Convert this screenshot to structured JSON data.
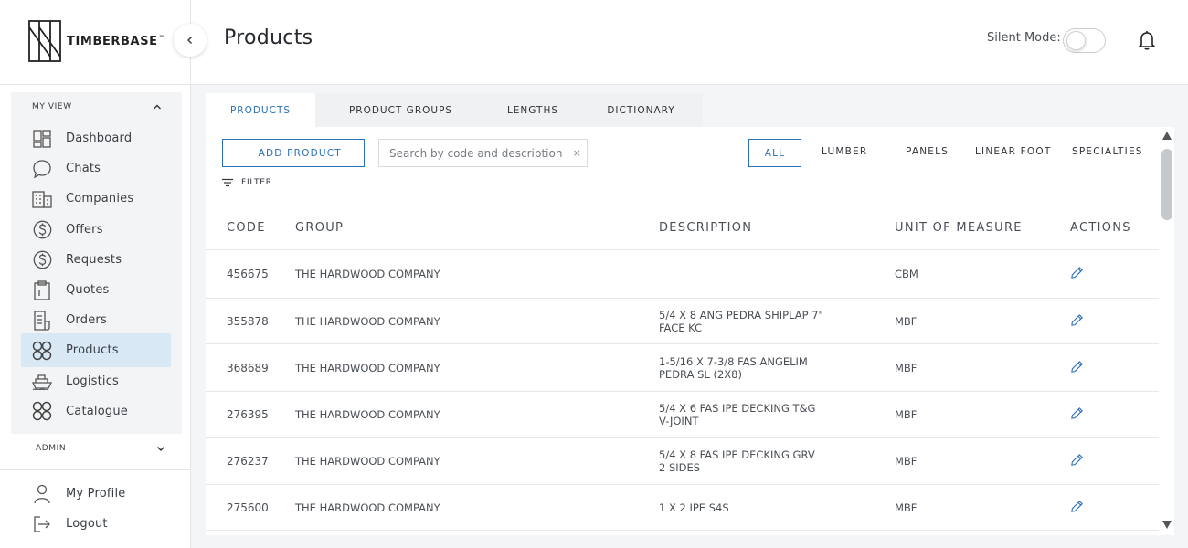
{
  "brand": {
    "name": "TIMBERBASE",
    "tm": "™"
  },
  "sidebar": {
    "section_myview": "MY VIEW",
    "section_admin": "ADMIN",
    "items": [
      {
        "label": "Dashboard",
        "icon": "dashboard-icon"
      },
      {
        "label": "Chats",
        "icon": "chat-icon"
      },
      {
        "label": "Companies",
        "icon": "building-icon"
      },
      {
        "label": "Offers",
        "icon": "dollar-circle-icon"
      },
      {
        "label": "Requests",
        "icon": "dollar-circle-icon"
      },
      {
        "label": "Quotes",
        "icon": "clipboard-icon"
      },
      {
        "label": "Orders",
        "icon": "document-list-icon"
      },
      {
        "label": "Products",
        "icon": "products-grid-icon",
        "active": true
      },
      {
        "label": "Logistics",
        "icon": "ship-icon"
      },
      {
        "label": "Catalogue",
        "icon": "products-grid-icon"
      }
    ],
    "bottom": [
      {
        "label": "My Profile",
        "icon": "user-icon"
      },
      {
        "label": "Logout",
        "icon": "logout-icon"
      }
    ]
  },
  "header": {
    "title": "Products",
    "silent_mode_label": "Silent Mode:",
    "silent_mode_on": false
  },
  "tabs": [
    "PRODUCTS",
    "PRODUCT GROUPS",
    "LENGTHS",
    "DICTIONARY"
  ],
  "toolbar": {
    "add_label": "+ ADD PRODUCT",
    "search_placeholder": "Search by code and description",
    "clear": "×",
    "filter_label": "FILTER",
    "categories": [
      "ALL",
      "LUMBER",
      "PANELS",
      "LINEAR FOOT",
      "SPECIALTIES"
    ],
    "active_category": "ALL"
  },
  "table": {
    "columns": [
      "CODE",
      "GROUP",
      "DESCRIPTION",
      "UNIT OF MEASURE",
      "ACTIONS"
    ],
    "rows": [
      {
        "code": "456675",
        "group": "THE HARDWOOD COMPANY",
        "desc1": "",
        "desc2": "",
        "uom": "CBM"
      },
      {
        "code": "355878",
        "group": "THE HARDWOOD COMPANY",
        "desc1": "5/4 X 8 ANG PEDRA SHIPLAP 7\"",
        "desc2": "FACE KC",
        "uom": "MBF"
      },
      {
        "code": "368689",
        "group": "THE HARDWOOD COMPANY",
        "desc1": "1-5/16 X 7-3/8 FAS ANGELIM",
        "desc2": "PEDRA SL (2X8)",
        "uom": "MBF"
      },
      {
        "code": "276395",
        "group": "THE HARDWOOD COMPANY",
        "desc1": "5/4 X 6 FAS IPE DECKING T&G",
        "desc2": "V-JOINT",
        "uom": "MBF"
      },
      {
        "code": "276237",
        "group": "THE HARDWOOD COMPANY",
        "desc1": "5/4 X 8 FAS IPE DECKING GRV",
        "desc2": "2 SIDES",
        "uom": "MBF"
      },
      {
        "code": "275600",
        "group": "THE HARDWOOD COMPANY",
        "desc1": "1 X 2 IPE S4S",
        "desc2": "",
        "uom": "MBF"
      }
    ]
  },
  "colors": {
    "accent": "#2a6fb8",
    "active_nav": "#d9e8f5",
    "background": "#f4f5f6"
  }
}
